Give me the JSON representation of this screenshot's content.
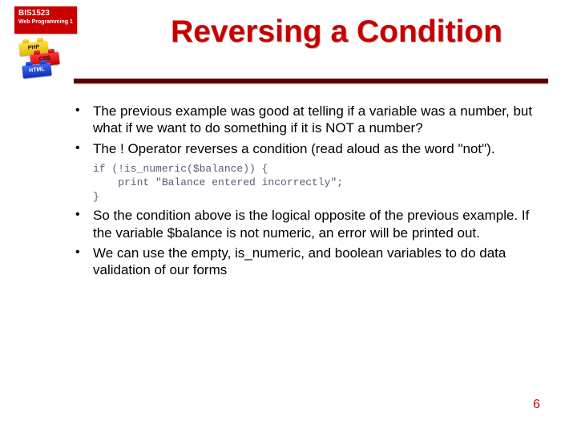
{
  "course": {
    "code": "BIS1523",
    "name": "Web Programming 1"
  },
  "bricks": {
    "top": "PHP",
    "mid": "CSS",
    "bot": "HTML"
  },
  "title": "Reversing a Condition",
  "bullets": {
    "b1": "The previous example was good at telling if a variable was a number, but what if we want to do something if it is NOT a number?",
    "b2": "The ! Operator reverses a condition (read aloud as the word \"not\").",
    "b3": "So the condition above is the logical opposite of the previous example.  If the variable $balance is not numeric, an error will be printed out.",
    "b4": "We can use the empty, is_numeric, and boolean variables to do data validation of our forms"
  },
  "code": "if (!is_numeric($balance)) {\n    print \"Balance entered incorrectly\";\n}",
  "page": "6"
}
